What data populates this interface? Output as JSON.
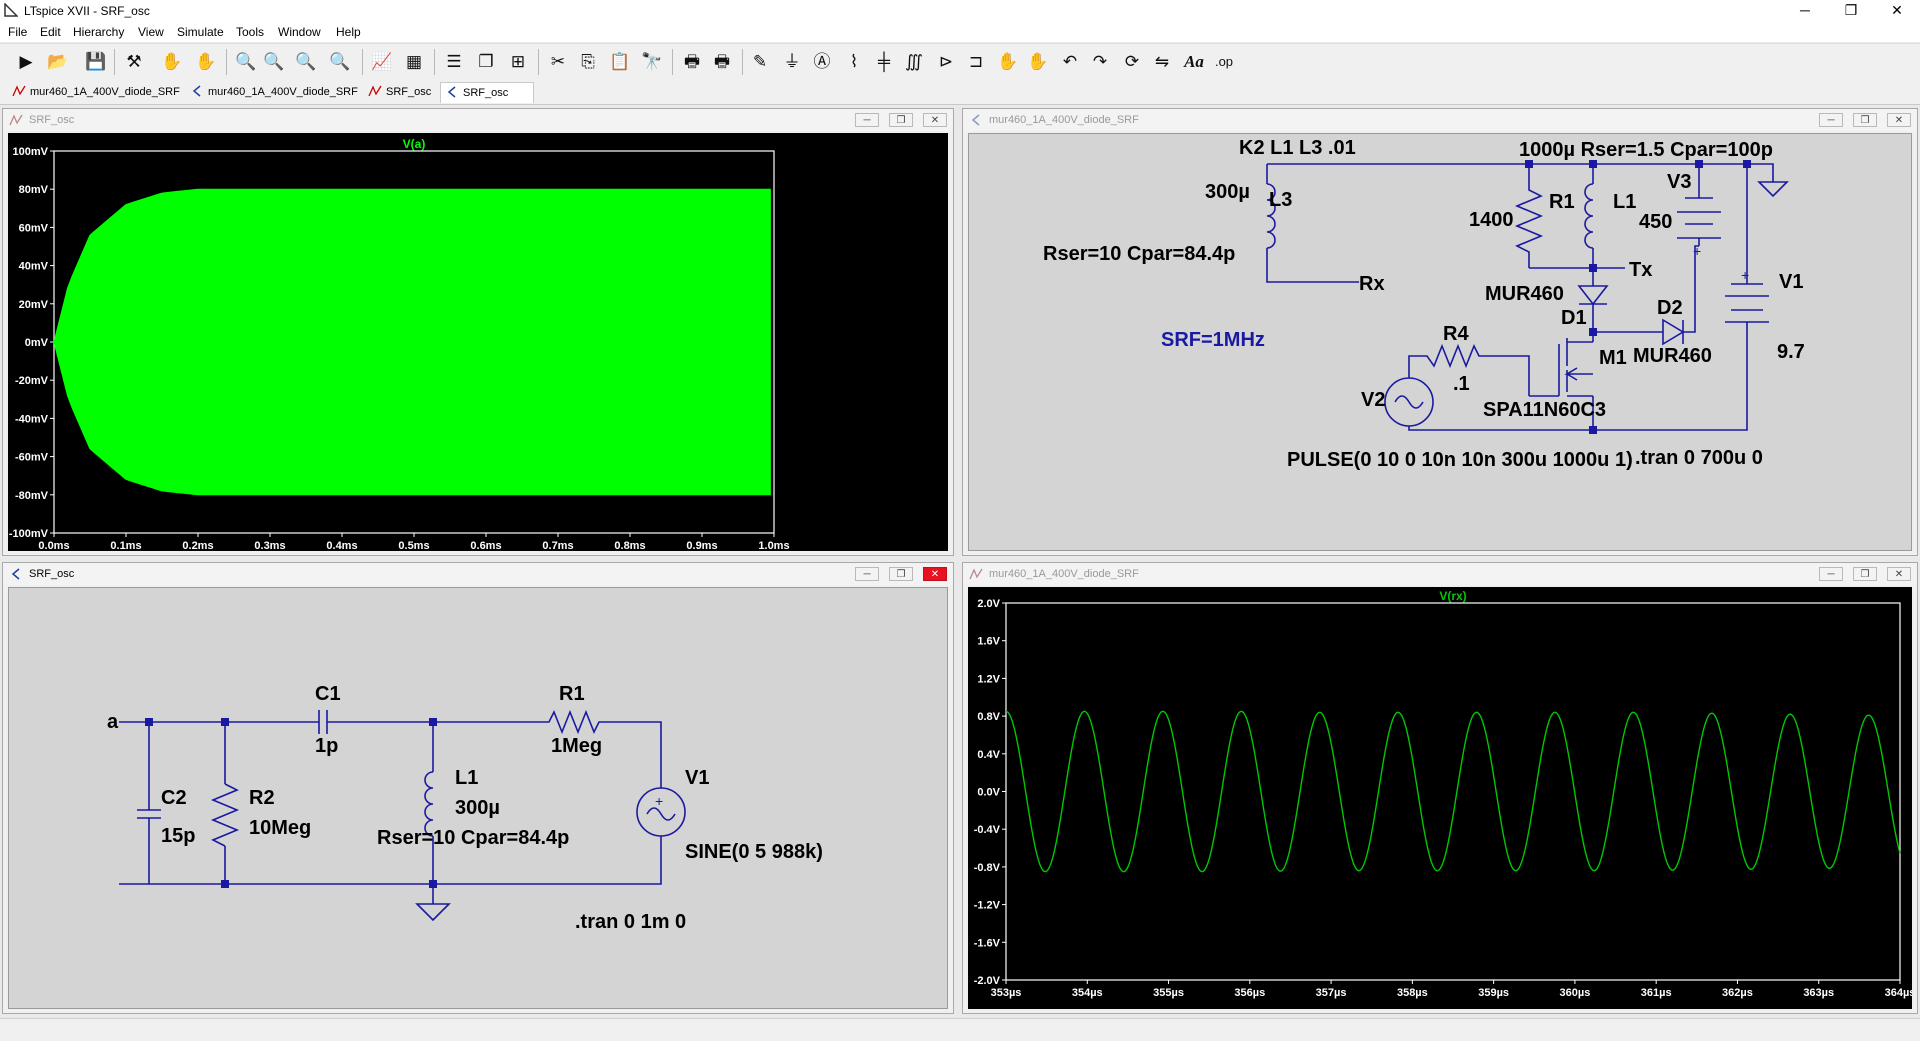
{
  "app": {
    "title": "LTspice XVII - SRF_osc"
  },
  "window_controls": {
    "minimize": "─",
    "maximize": "❐",
    "close": "✕"
  },
  "menu": [
    "File",
    "Edit",
    "Hierarchy",
    "View",
    "Simulate",
    "Tools",
    "Window",
    "Help"
  ],
  "toolbar": [
    "run-icon",
    "open-icon",
    "save-icon",
    "control-panel-icon",
    "halt-icon",
    "pan-icon",
    "zoom-in-icon",
    "zoom-area-icon",
    "zoom-out-icon",
    "zoom-fit-icon",
    "autorange-icon",
    "grid-icon",
    "tile-horizontal-icon",
    "cascade-icon",
    "tile-vertical-icon",
    "cut-icon",
    "copy-icon",
    "paste-icon",
    "find-icon",
    "print-icon",
    "print-preview-icon",
    "draw-wire-icon",
    "ground-icon",
    "label-net-icon",
    "resistor-icon",
    "capacitor-icon",
    "inductor-icon",
    "diode-icon",
    "component-icon",
    "move-icon",
    "drag-icon",
    "undo-icon",
    "redo-icon",
    "rotate-icon",
    "mirror-icon",
    "text-icon",
    "spice-directive-icon"
  ],
  "tabs": [
    {
      "label": "mur460_1A_400V_diode_SRF",
      "icon": "waveform-icon"
    },
    {
      "label": "mur460_1A_400V_diode_SRF",
      "icon": "schematic-icon"
    },
    {
      "label": "SRF_osc",
      "icon": "waveform-icon"
    },
    {
      "label": "SRF_osc",
      "icon": "schematic-icon",
      "active": true
    }
  ],
  "windows": {
    "w1": {
      "title": "SRF_osc",
      "kind": "waveform"
    },
    "w2": {
      "title": "mur460_1A_400V_diode_SRF",
      "kind": "schematic"
    },
    "w3": {
      "title": "SRF_osc",
      "kind": "schematic"
    },
    "w4": {
      "title": "mur460_1A_400V_diode_SRF",
      "kind": "waveform"
    }
  },
  "mdi_buttons": {
    "minimize": "─",
    "restore": "❐",
    "close": "✕"
  },
  "plots": {
    "va": {
      "trace": "V(a)",
      "color": "#00ff00",
      "y_ticks": [
        "100mV",
        "80mV",
        "60mV",
        "40mV",
        "20mV",
        "0mV",
        "-20mV",
        "-40mV",
        "-60mV",
        "-80mV",
        "-100mV"
      ],
      "x_ticks": [
        "0.0ms",
        "0.1ms",
        "0.2ms",
        "0.3ms",
        "0.4ms",
        "0.5ms",
        "0.6ms",
        "0.7ms",
        "0.8ms",
        "0.9ms",
        "1.0ms"
      ]
    },
    "vrx": {
      "trace": "V(rx)",
      "color": "#00c800",
      "y_ticks": [
        "2.0V",
        "1.6V",
        "1.2V",
        "0.8V",
        "0.4V",
        "0.0V",
        "-0.4V",
        "-0.8V",
        "-1.2V",
        "-1.6V",
        "-2.0V"
      ],
      "x_ticks": [
        "353µs",
        "354µs",
        "355µs",
        "356µs",
        "357µs",
        "358µs",
        "359µs",
        "360µs",
        "361µs",
        "362µs",
        "363µs",
        "364µs"
      ]
    }
  },
  "chart_data": [
    {
      "type": "area",
      "title": "V(a)",
      "xlabel": "",
      "ylabel": "",
      "x_range_ms": [
        0,
        1.0
      ],
      "ylim_mV": [
        -100,
        100
      ],
      "grid": false,
      "series": [
        {
          "name": "V(a)",
          "x_ms": [
            0,
            0.02,
            0.05,
            0.1,
            0.15,
            0.2,
            0.3,
            0.5,
            0.7,
            1.0
          ],
          "upper_mV": [
            0,
            30,
            56,
            72,
            78,
            80,
            80,
            80,
            80,
            80
          ],
          "lower_mV": [
            0,
            -30,
            -56,
            -72,
            -78,
            -80,
            -80,
            -80,
            -80,
            -80
          ]
        }
      ]
    },
    {
      "type": "line",
      "title": "V(rx)",
      "xlabel": "",
      "ylabel": "",
      "x_range_us": [
        353,
        364.4
      ],
      "ylim_V": [
        -2.0,
        2.0
      ],
      "grid": false,
      "series": [
        {
          "name": "V(rx)",
          "amplitude_V": 0.85,
          "frequency_MHz": 1.0,
          "x_us": [
            353,
            354,
            355,
            356,
            357,
            358,
            359,
            360,
            361,
            362,
            363,
            364
          ],
          "y_V": [
            0.85,
            0.85,
            0.85,
            0.85,
            0.84,
            0.84,
            0.84,
            0.84,
            0.84,
            0.83,
            0.82,
            0.81
          ]
        }
      ]
    }
  ],
  "schematic_main": {
    "directive_k": "K2 L1 L3 .01",
    "l1_params": "1000µ Rser=1.5 Cpar=100p",
    "l3_value": "300µ",
    "l3_name": "L3",
    "l3_params": "Rser=10 Cpar=84.4p",
    "rx_label": "Rx",
    "tx_label": "Tx",
    "r1_value": "1400",
    "r1_name": "R1",
    "l1_name": "L1",
    "v3_name": "V3",
    "v3_value": "450",
    "v1_name": "V1",
    "v1_value": "9.7",
    "d1_model": "MUR460",
    "d1_name": "D1",
    "d2_name": "D2",
    "d2_model": "MUR460",
    "m1_name": "M1",
    "m1_model": "SPA11N60C3",
    "r4_name": "R4",
    "r4_value": ".1",
    "v2_name": "V2",
    "srf": "SRF=1MHz",
    "pulse": "PULSE(0 10 0 10n 10n 300u 1000u 1)",
    "tran": ".tran 0 700u 0"
  },
  "schematic_srf": {
    "node_a": "a",
    "c1_name": "C1",
    "c1_value": "1p",
    "r1_name": "R1",
    "r1_value": "1Meg",
    "c2_name": "C2",
    "c2_value": "15p",
    "r2_name": "R2",
    "r2_value": "10Meg",
    "l1_name": "L1",
    "l1_value": "300µ",
    "l1_params": "Rser=10 Cpar=84.4p",
    "v1_name": "V1",
    "v1_value": "SINE(0 5 988k)",
    "tran": ".tran 0 1m 0"
  }
}
